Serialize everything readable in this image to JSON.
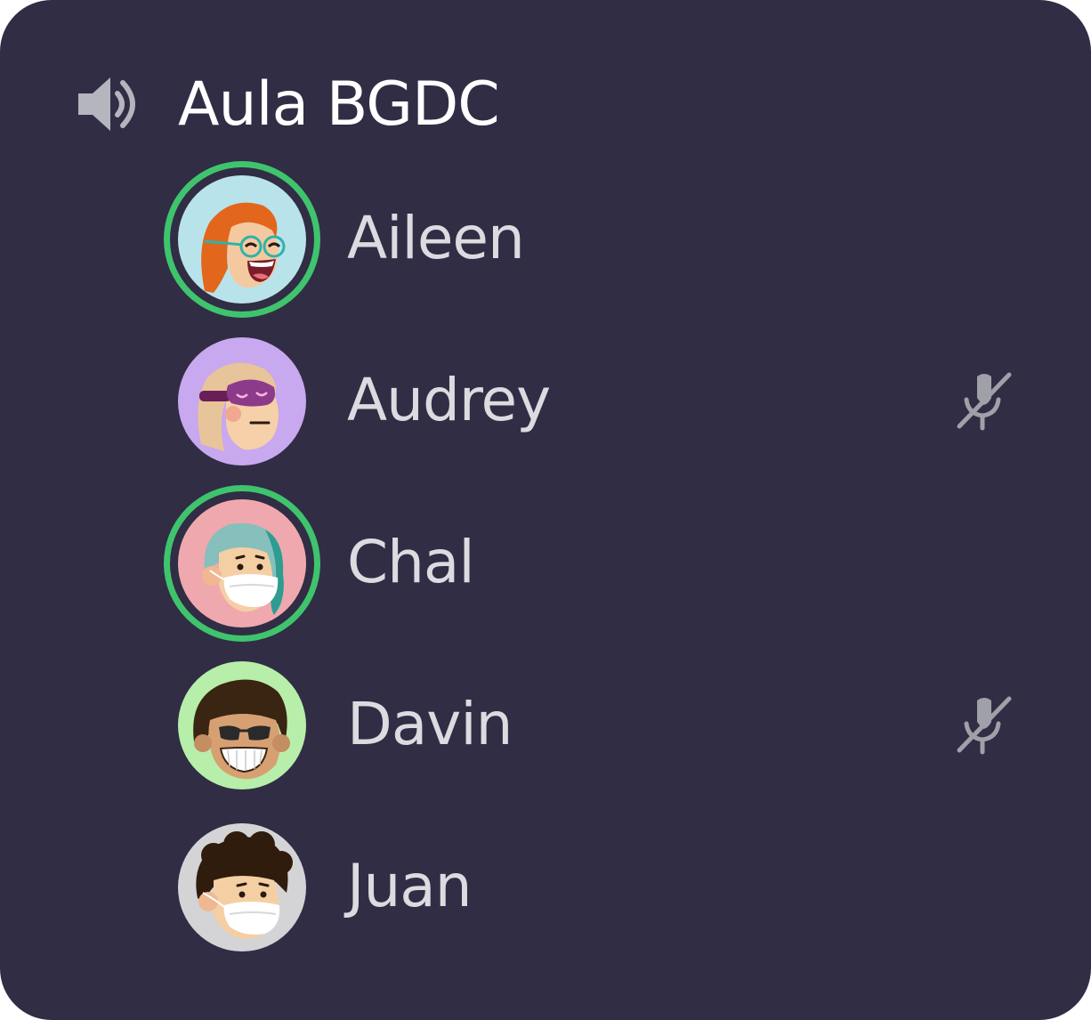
{
  "channel": {
    "name": "Aula BGDC",
    "icon": "speaker-icon"
  },
  "colors": {
    "panel_bg": "#302d45",
    "speaking_ring": "#3fc46d",
    "name_text": "#dbdbe0",
    "icon_gray": "#b5b5bd"
  },
  "members": [
    {
      "name": "Aileen",
      "speaking": true,
      "muted": false,
      "avatar_bg": "#b9e3ea"
    },
    {
      "name": "Audrey",
      "speaking": false,
      "muted": true,
      "avatar_bg": "#c8a8ee"
    },
    {
      "name": "Chal",
      "speaking": true,
      "muted": false,
      "avatar_bg": "#efa9ae"
    },
    {
      "name": "Davin",
      "speaking": false,
      "muted": true,
      "avatar_bg": "#b7eea9"
    },
    {
      "name": "Juan",
      "speaking": false,
      "muted": false,
      "avatar_bg": "#d4d4d6"
    }
  ]
}
